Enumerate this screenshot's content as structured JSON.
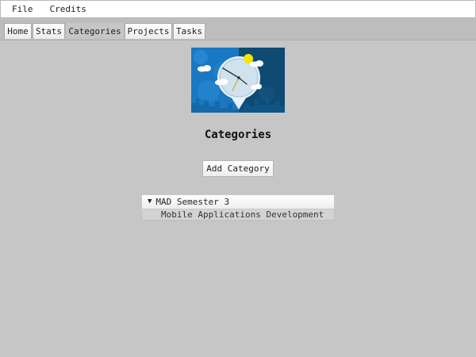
{
  "menubar": {
    "items": [
      {
        "label": "File"
      },
      {
        "label": "Credits"
      }
    ]
  },
  "tabs": {
    "items": [
      {
        "label": "Home",
        "active": false
      },
      {
        "label": "Stats",
        "active": false
      },
      {
        "label": "Categories",
        "active": true
      },
      {
        "label": "Projects",
        "active": false
      },
      {
        "label": "Tasks",
        "active": false
      }
    ]
  },
  "main": {
    "banner_icon": "clock-map-pin-icon",
    "title": "Categories",
    "add_button_label": "Add Category"
  },
  "categories": {
    "items": [
      {
        "name": "MAD Semester 3",
        "expanded": true,
        "children": [
          {
            "label": "Mobile Applications Development"
          }
        ]
      }
    ]
  },
  "colors": {
    "background": "#c6c6c6",
    "banner_blue": "#1a78c2",
    "banner_dark": "#0f4a73",
    "sun": "#f2e600"
  }
}
